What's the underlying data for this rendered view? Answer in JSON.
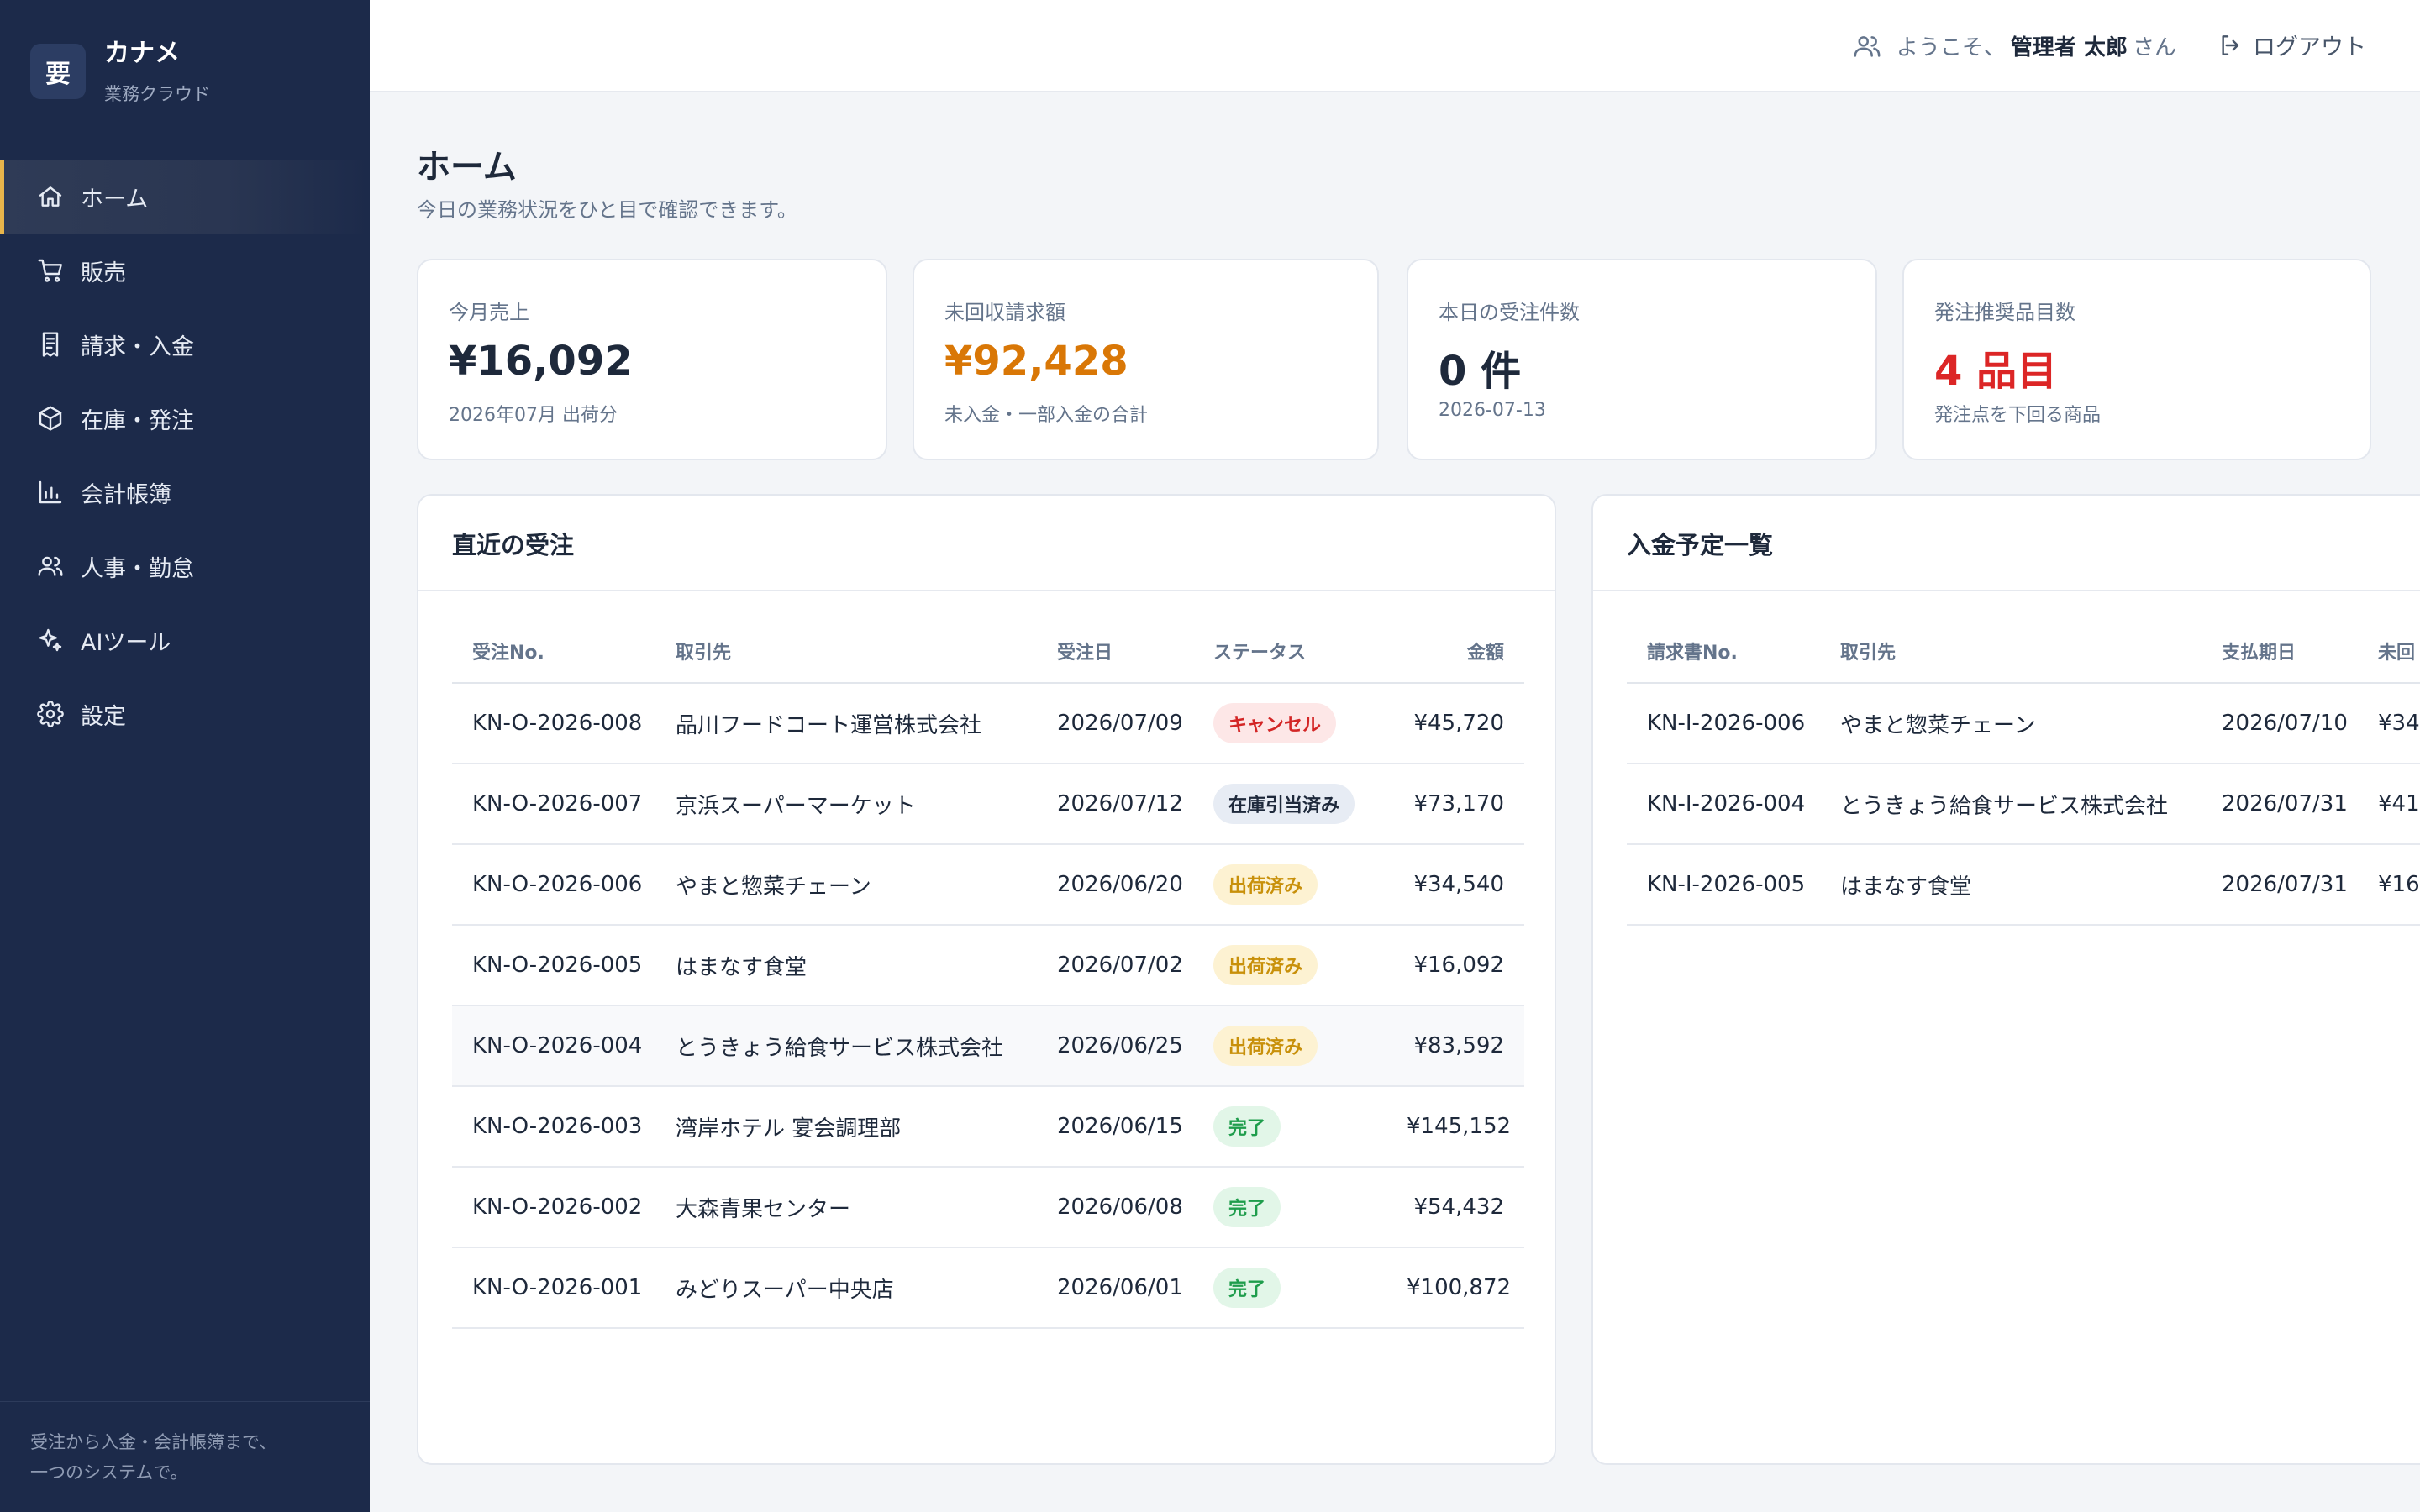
{
  "brand": {
    "logo_char": "要",
    "name": "カナメ",
    "sub": "業務クラウド"
  },
  "nav": [
    {
      "label": "ホーム",
      "icon": "home-icon",
      "active": true
    },
    {
      "label": "販売",
      "icon": "cart-icon"
    },
    {
      "label": "請求・入金",
      "icon": "receipt-icon"
    },
    {
      "label": "在庫・発注",
      "icon": "box-icon"
    },
    {
      "label": "会計帳簿",
      "icon": "bar-chart-icon"
    },
    {
      "label": "人事・勤怠",
      "icon": "users-icon"
    },
    {
      "label": "AIツール",
      "icon": "sparkle-icon"
    },
    {
      "label": "設定",
      "icon": "gear-icon"
    }
  ],
  "sidebar_footer": {
    "line1": "受注から入金・会計帳簿まで、",
    "line2": "一つのシステムで。"
  },
  "header": {
    "welcome_prefix": "ようこそ、",
    "user_name": "管理者 太郎",
    "welcome_suffix": "さん",
    "logout_label": "ログアウト"
  },
  "page": {
    "title": "ホーム",
    "subtitle": "今日の業務状況をひと目で確認できます。"
  },
  "stats": [
    {
      "label": "今月売上",
      "value": "¥16,092",
      "note": "2026年07月 出荷分",
      "color": "#1e293b"
    },
    {
      "label": "未回収請求額",
      "value": "¥92,428",
      "note": "未入金・一部入金の合計",
      "color": "#d97706"
    },
    {
      "label": "本日の受注件数",
      "value": "0 件",
      "note": "2026-07-13",
      "color": "#1e293b"
    },
    {
      "label": "発注推奨品目数",
      "value": "4 品目",
      "note": "発注点を下回る商品",
      "color": "#dc2626"
    }
  ],
  "orders": {
    "title": "直近の受注",
    "columns": [
      "受注No.",
      "取引先",
      "受注日",
      "ステータス",
      "金額"
    ],
    "rows": [
      {
        "no": "KN-O-2026-008",
        "client": "品川フードコート運営株式会社",
        "date": "2026/07/09",
        "status": "キャンセル",
        "status_color": "red",
        "amount": "¥45,720"
      },
      {
        "no": "KN-O-2026-007",
        "client": "京浜スーパーマーケット",
        "date": "2026/07/12",
        "status": "在庫引当済み",
        "status_color": "gray",
        "amount": "¥73,170"
      },
      {
        "no": "KN-O-2026-006",
        "client": "やまと惣菜チェーン",
        "date": "2026/06/20",
        "status": "出荷済み",
        "status_color": "yellow",
        "amount": "¥34,540"
      },
      {
        "no": "KN-O-2026-005",
        "client": "はまなす食堂",
        "date": "2026/07/02",
        "status": "出荷済み",
        "status_color": "yellow",
        "amount": "¥16,092"
      },
      {
        "no": "KN-O-2026-004",
        "client": "とうきょう給食サービス株式会社",
        "date": "2026/06/25",
        "status": "出荷済み",
        "status_color": "yellow",
        "amount": "¥83,592"
      },
      {
        "no": "KN-O-2026-003",
        "client": "湾岸ホテル 宴会調理部",
        "date": "2026/06/15",
        "status": "完了",
        "status_color": "green",
        "amount": "¥145,152"
      },
      {
        "no": "KN-O-2026-002",
        "client": "大森青果センター",
        "date": "2026/06/08",
        "status": "完了",
        "status_color": "green",
        "amount": "¥54,432"
      },
      {
        "no": "KN-O-2026-001",
        "client": "みどりスーパー中央店",
        "date": "2026/06/01",
        "status": "完了",
        "status_color": "green",
        "amount": "¥100,872"
      }
    ]
  },
  "payments": {
    "title": "入金予定一覧",
    "columns": [
      "請求書No.",
      "取引先",
      "支払期日",
      "未回"
    ],
    "rows": [
      {
        "no": "KN-I-2026-006",
        "client": "やまと惣菜チェーン",
        "date": "2026/07/10",
        "amount": "¥34,"
      },
      {
        "no": "KN-I-2026-004",
        "client": "とうきょう給食サービス株式会社",
        "date": "2026/07/31",
        "amount": "¥41,"
      },
      {
        "no": "KN-I-2026-005",
        "client": "はまなす食堂",
        "date": "2026/07/31",
        "amount": "¥16,"
      }
    ]
  }
}
